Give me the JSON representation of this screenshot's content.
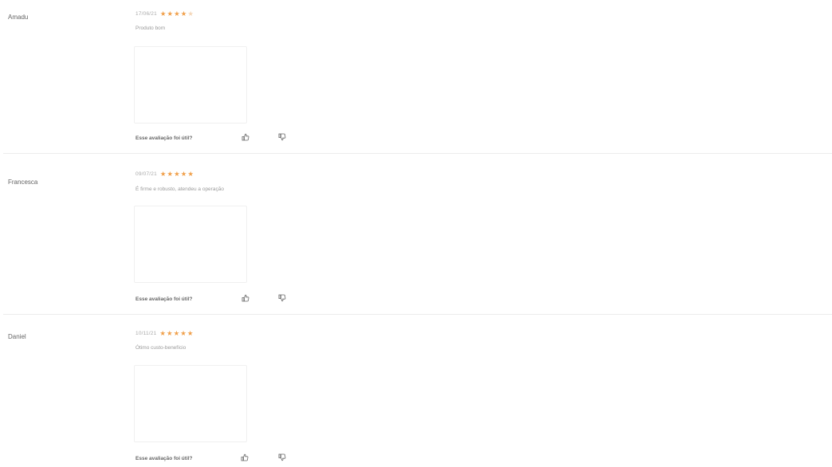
{
  "reviews": [
    {
      "author": "Amadu",
      "date": "17/06/21",
      "rating": 4,
      "comment": "Produto bom",
      "helpful_prompt": "Esse avaliação foi útil?"
    },
    {
      "author": "Francesca",
      "date": "09/07/21",
      "rating": 5,
      "comment": "É firme e robusto, atendeu a operação",
      "helpful_prompt": "Esse avaliação foi útil?"
    },
    {
      "author": "Daniel",
      "date": "10/11/21",
      "rating": 5,
      "comment": "Ótimo custo-benefício",
      "helpful_prompt": "Esse avaliação foi útil?"
    }
  ],
  "colors": {
    "star_filled": "#f0a04b",
    "star_empty": "#f4d6b8",
    "divider": "#ececec"
  },
  "icons": {
    "like": "thumb-up-icon",
    "dislike": "thumb-down-icon"
  }
}
